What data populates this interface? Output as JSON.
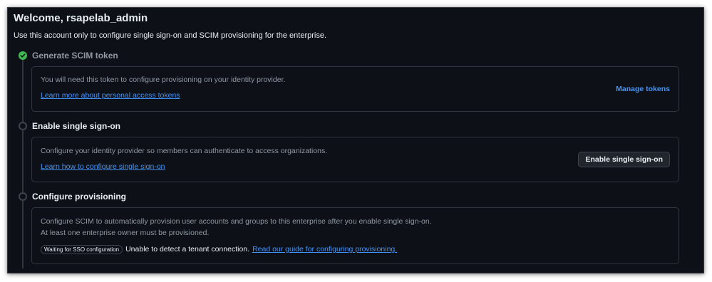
{
  "header": {
    "title": "Welcome, rsapelab_admin",
    "subtitle": "Use this account only to configure single sign-on and SCIM provisioning for the enterprise."
  },
  "steps": [
    {
      "title": "Generate SCIM token",
      "status": "complete",
      "description": "You will need this token to configure provisioning on your identity provider.",
      "link": "Learn more about personal access tokens",
      "action": "Manage tokens"
    },
    {
      "title": "Enable single sign-on",
      "status": "pending",
      "description": "Configure your identity provider so members can authenticate to access organizations.",
      "link": "Learn how to configure single sign-on",
      "action": "Enable single sign-on"
    },
    {
      "title": "Configure provisioning",
      "status": "pending",
      "description_lines": [
        "Configure SCIM to automatically provision user accounts and groups to this enterprise after you enable single sign-on.",
        "At least one enterprise owner must be provisioned."
      ],
      "badge": "Waiting for SSO configuration",
      "status_text": "Unable to detect a tenant connection.",
      "link": "Read our guide for configuring provisioning."
    }
  ],
  "colors": {
    "background": "#0d1117",
    "border": "#30363d",
    "text": "#e6edf3",
    "muted": "#9198a1",
    "link": "#4493f8",
    "success": "#3fb950"
  },
  "icons": {
    "step_complete": "check-circle-icon",
    "step_pending": "circle-icon"
  }
}
